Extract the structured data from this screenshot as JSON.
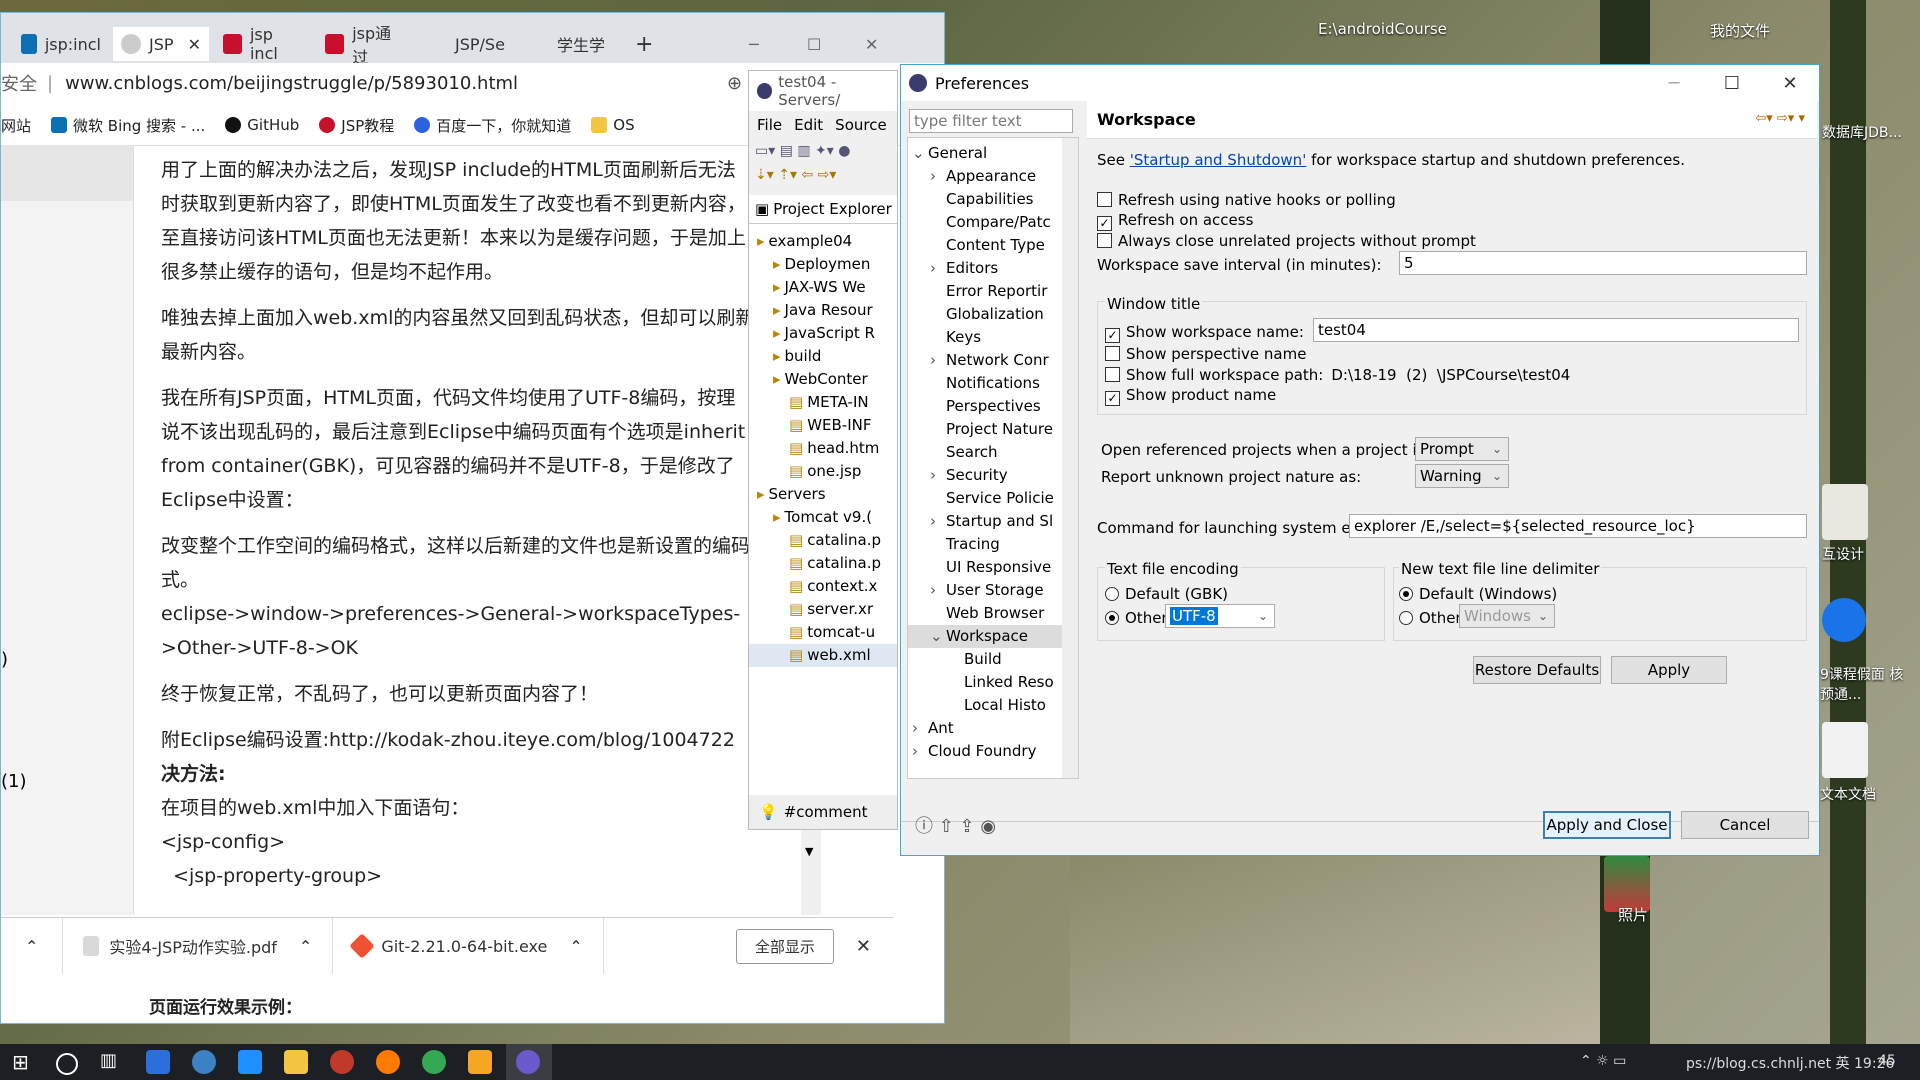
{
  "desktop": {
    "labels": [
      "E:\\androidCourse",
      "我的文件",
      "数据库JDB...",
      "互设计",
      "9课程假面 核预通...",
      "文本文档",
      "照片"
    ]
  },
  "browser": {
    "tabs": [
      "jsp:incl",
      "JSP",
      "jsp incl",
      "jsp通过",
      "JSP/Se",
      "学生学"
    ],
    "new_tab": "+",
    "address_prefix": "安全",
    "url": "www.cnblogs.com/beijingstruggle/p/5893010.html",
    "bookmarks": [
      "网站",
      "微软 Bing 搜索 - ...",
      "GitHub",
      "JSP教程",
      "百度一下，你就知道",
      "OS"
    ],
    "paragraphs": [
      "用了上面的解决办法之后，发现JSP include的HTML页面刷新后无法",
      "时获取到更新内容了，即使HTML页面发生了改变也看不到更新内容，",
      "至直接访问该HTML页面也无法更新！本来以为是缓存问题，于是加上",
      "很多禁止缓存的语句，但是均不起作用。",
      "唯独去掉上面加入web.xml的内容虽然又回到乱码状态，但却可以刷新",
      "最新内容。",
      "我在所有JSP页面，HTML页面，代码文件均使用了UTF-8编码，按理",
      "说不该出现乱码的，最后注意到Eclipse中编码页面有个选项是inherit",
      "from container(GBK)，可见容器的编码并不是UTF-8，于是修改了",
      "Eclipse中设置：",
      "改变整个工作空间的编码格式，这样以后新建的文件也是新设置的编码",
      "式。",
      "eclipse->window->preferences->General->workspaceTypes-",
      ">Other->UTF-8->OK",
      "终于恢复正常，不乱码了，也可以更新页面内容了！",
      "附Eclipse编码设置:http://kodak-zhou.iteye.com/blog/1004722",
      "决方法:",
      "在项目的web.xml中加入下面语句：",
      "<jsp-config>",
      "  <jsp-property-group>"
    ],
    "left_marks": [
      ")",
      "(1)"
    ],
    "downloads": [
      "实验4-JSP动作实验.pdf",
      "Git-2.21.0-64-bit.exe"
    ],
    "show_all": "全部显示",
    "bottom_text": "页面运行效果示例："
  },
  "ide": {
    "title": "test04 - Servers/",
    "menu": [
      "File",
      "Edit",
      "Source"
    ],
    "panel_title": "Project Explorer",
    "tree": [
      {
        "label": "example04",
        "indent": 0,
        "sel": false
      },
      {
        "label": "Deploymen",
        "indent": 1,
        "sel": false
      },
      {
        "label": "JAX-WS We",
        "indent": 1,
        "sel": false
      },
      {
        "label": "Java Resour",
        "indent": 1,
        "sel": false
      },
      {
        "label": "JavaScript R",
        "indent": 1,
        "sel": false
      },
      {
        "label": "build",
        "indent": 1,
        "sel": false
      },
      {
        "label": "WebConter",
        "indent": 1,
        "sel": false
      },
      {
        "label": "META-IN",
        "indent": 2,
        "sel": false
      },
      {
        "label": "WEB-INF",
        "indent": 2,
        "sel": false
      },
      {
        "label": "head.htm",
        "indent": 2,
        "sel": false
      },
      {
        "label": "one.jsp",
        "indent": 2,
        "sel": false
      },
      {
        "label": "Servers",
        "indent": 0,
        "sel": false
      },
      {
        "label": "Tomcat v9.(",
        "indent": 1,
        "sel": false
      },
      {
        "label": "catalina.p",
        "indent": 2,
        "sel": false
      },
      {
        "label": "catalina.p",
        "indent": 2,
        "sel": false
      },
      {
        "label": "context.x",
        "indent": 2,
        "sel": false
      },
      {
        "label": "server.xr",
        "indent": 2,
        "sel": false
      },
      {
        "label": "tomcat-u",
        "indent": 2,
        "sel": false
      },
      {
        "label": "web.xml",
        "indent": 2,
        "sel": true
      }
    ],
    "bottom_label": "#comment"
  },
  "prefs": {
    "title": "Preferences",
    "filter_placeholder": "type filter text",
    "tree": [
      {
        "label": "General",
        "indent": 0,
        "arrow": "v",
        "sel": false
      },
      {
        "label": "Appearance",
        "indent": 1,
        "arrow": ">",
        "sel": false
      },
      {
        "label": "Capabilities",
        "indent": 1,
        "arrow": "",
        "sel": false
      },
      {
        "label": "Compare/Patc",
        "indent": 1,
        "arrow": "",
        "sel": false
      },
      {
        "label": "Content Type",
        "indent": 1,
        "arrow": "",
        "sel": false
      },
      {
        "label": "Editors",
        "indent": 1,
        "arrow": ">",
        "sel": false
      },
      {
        "label": "Error Reportir",
        "indent": 1,
        "arrow": "",
        "sel": false
      },
      {
        "label": "Globalization",
        "indent": 1,
        "arrow": "",
        "sel": false
      },
      {
        "label": "Keys",
        "indent": 1,
        "arrow": "",
        "sel": false
      },
      {
        "label": "Network Conr",
        "indent": 1,
        "arrow": ">",
        "sel": false
      },
      {
        "label": "Notifications",
        "indent": 1,
        "arrow": "",
        "sel": false
      },
      {
        "label": "Perspectives",
        "indent": 1,
        "arrow": "",
        "sel": false
      },
      {
        "label": "Project Nature",
        "indent": 1,
        "arrow": "",
        "sel": false
      },
      {
        "label": "Search",
        "indent": 1,
        "arrow": "",
        "sel": false
      },
      {
        "label": "Security",
        "indent": 1,
        "arrow": ">",
        "sel": false
      },
      {
        "label": "Service Policie",
        "indent": 1,
        "arrow": "",
        "sel": false
      },
      {
        "label": "Startup and Sl",
        "indent": 1,
        "arrow": ">",
        "sel": false
      },
      {
        "label": "Tracing",
        "indent": 1,
        "arrow": "",
        "sel": false
      },
      {
        "label": "UI Responsive",
        "indent": 1,
        "arrow": "",
        "sel": false
      },
      {
        "label": "User Storage",
        "indent": 1,
        "arrow": ">",
        "sel": false
      },
      {
        "label": "Web Browser",
        "indent": 1,
        "arrow": "",
        "sel": false
      },
      {
        "label": "Workspace",
        "indent": 1,
        "arrow": "v",
        "sel": true
      },
      {
        "label": "Build",
        "indent": 2,
        "arrow": "",
        "sel": false
      },
      {
        "label": "Linked Reso",
        "indent": 2,
        "arrow": "",
        "sel": false
      },
      {
        "label": "Local Histo",
        "indent": 2,
        "arrow": "",
        "sel": false
      },
      {
        "label": "Ant",
        "indent": 0,
        "arrow": ">",
        "sel": false
      },
      {
        "label": "Cloud Foundry",
        "indent": 0,
        "arrow": ">",
        "sel": false
      }
    ],
    "page_title": "Workspace",
    "see_prefix": "See ",
    "see_link": "'Startup and Shutdown'",
    "see_suffix": " for workspace startup and shutdown preferences.",
    "refresh_native": "Refresh using native hooks or polling",
    "refresh_access": "Refresh on access",
    "always_close": "Always close unrelated projects without prompt",
    "save_interval_label": "Workspace save interval (in minutes):",
    "save_interval_value": "5",
    "window_title_group": "Window title",
    "show_ws_name": "Show workspace name:",
    "ws_name_value": "test04",
    "show_perspective": "Show perspective name",
    "show_full_path": "Show full workspace path:",
    "full_path_value": "D:\\18-19  (2)  \\JSPCourse\\test04",
    "show_product": "Show product name",
    "open_ref_label": "Open referenced projects when a project is opened:",
    "open_ref_value": "Prompt",
    "report_label": "Report unknown project nature as:",
    "report_value": "Warning",
    "explorer_label": "Command for launching system explorer:",
    "explorer_value": "explorer /E,/select=${selected_resource_loc}",
    "encoding_group": "Text file encoding",
    "enc_default": "Default (GBK)",
    "enc_other": "Other:",
    "enc_other_value": "UTF-8",
    "delim_group": "New text file line delimiter",
    "delim_default": "Default (Windows)",
    "delim_other": "Other:",
    "delim_other_value": "Windows",
    "restore_defaults": "Restore Defaults",
    "apply": "Apply",
    "apply_close": "Apply and Close",
    "cancel": "Cancel"
  },
  "taskbar": {
    "tray_text": "ps://blog.cs.chnlj.net  英 19:26",
    "tray_right": "45"
  }
}
